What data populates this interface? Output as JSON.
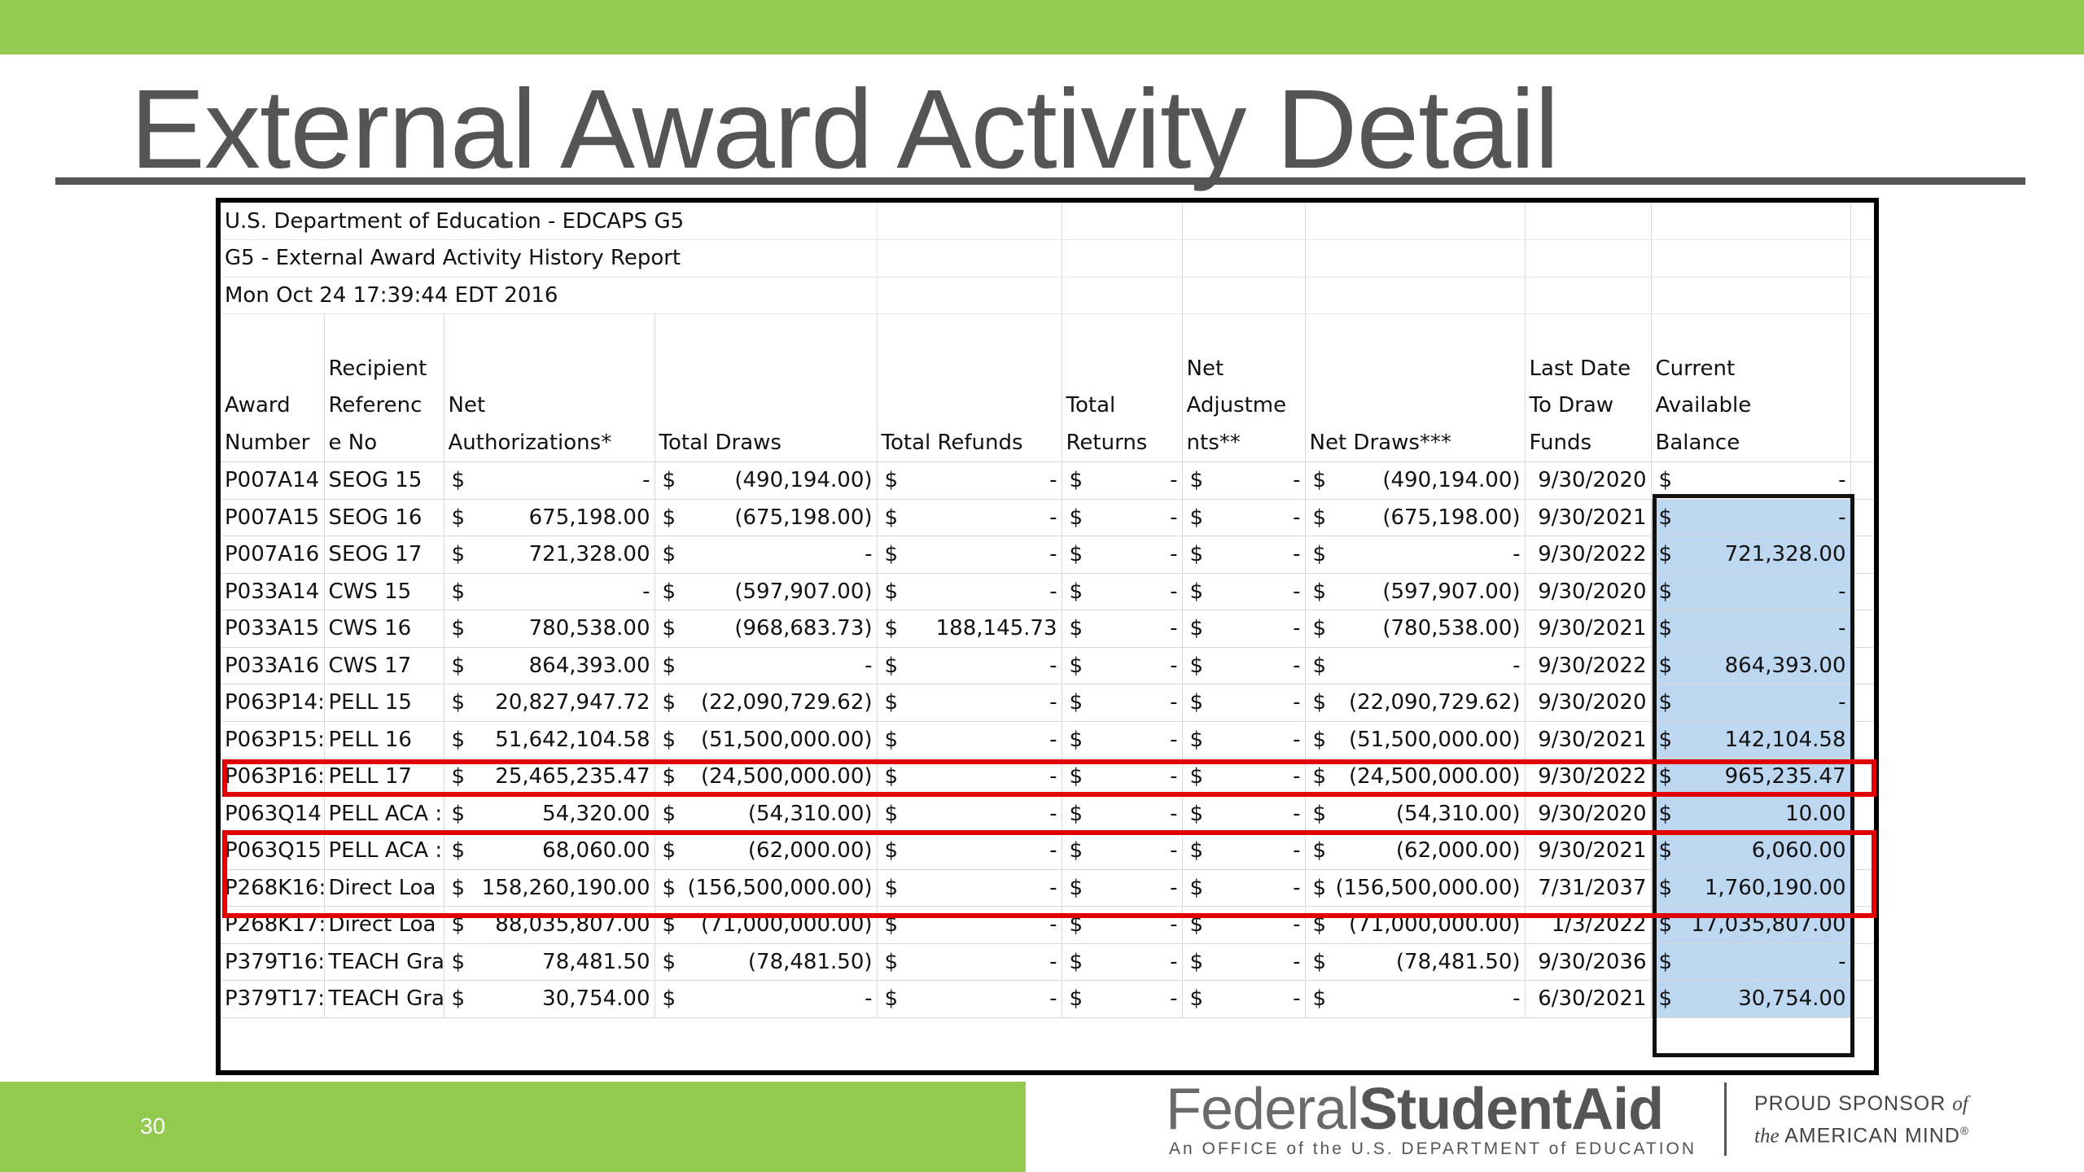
{
  "slide": {
    "title": "External Award Activity Detail",
    "page_number": "30"
  },
  "report": {
    "line1": "U.S. Department of Education - EDCAPS G5",
    "line2": "G5 - External Award Activity History Report",
    "line3": "Mon Oct 24 17:39:44 EDT 2016"
  },
  "headers": {
    "award_number": [
      "",
      "Award",
      "Number"
    ],
    "recipient_ref": [
      "Recipient",
      "Referenc",
      "e No"
    ],
    "net_auth": [
      "",
      "Net",
      "Authorizations*"
    ],
    "total_draws": [
      "",
      "",
      "Total Draws"
    ],
    "total_refunds": [
      "",
      "",
      "Total Refunds"
    ],
    "total_returns": [
      "",
      "Total",
      "Returns"
    ],
    "net_adjustments": [
      "Net",
      "Adjustme",
      "nts**"
    ],
    "net_draws": [
      "",
      "",
      "Net Draws***"
    ],
    "last_date": [
      "Last Date",
      "To Draw",
      "Funds"
    ],
    "current_balance": [
      "Current",
      "Available",
      "Balance"
    ]
  },
  "currency_symbol": "$",
  "dash": "-",
  "rows": [
    {
      "award": "P007A14",
      "ref": "SEOG 15",
      "net_auth": "-",
      "total_draws": "(490,194.00)",
      "total_refunds": "-",
      "total_returns": "-",
      "net_adj": "-",
      "net_draws": "(490,194.00)",
      "last_date": "9/30/2020",
      "balance": "-"
    },
    {
      "award": "P007A15",
      "ref": "SEOG 16",
      "net_auth": "675,198.00",
      "total_draws": "(675,198.00)",
      "total_refunds": "-",
      "total_returns": "-",
      "net_adj": "-",
      "net_draws": "(675,198.00)",
      "last_date": "9/30/2021",
      "balance": "-"
    },
    {
      "award": "P007A16",
      "ref": "SEOG 17",
      "net_auth": "721,328.00",
      "total_draws": "-",
      "total_refunds": "-",
      "total_returns": "-",
      "net_adj": "-",
      "net_draws": "-",
      "last_date": "9/30/2022",
      "balance": "721,328.00"
    },
    {
      "award": "P033A14",
      "ref": "CWS 15",
      "net_auth": "-",
      "total_draws": "(597,907.00)",
      "total_refunds": "-",
      "total_returns": "-",
      "net_adj": "-",
      "net_draws": "(597,907.00)",
      "last_date": "9/30/2020",
      "balance": "-"
    },
    {
      "award": "P033A15",
      "ref": "CWS 16",
      "net_auth": "780,538.00",
      "total_draws": "(968,683.73)",
      "total_refunds": "188,145.73",
      "total_returns": "-",
      "net_adj": "-",
      "net_draws": "(780,538.00)",
      "last_date": "9/30/2021",
      "balance": "-"
    },
    {
      "award": "P033A16",
      "ref": "CWS 17",
      "net_auth": "864,393.00",
      "total_draws": "-",
      "total_refunds": "-",
      "total_returns": "-",
      "net_adj": "-",
      "net_draws": "-",
      "last_date": "9/30/2022",
      "balance": "864,393.00"
    },
    {
      "award": "P063P14:",
      "ref": "PELL 15",
      "net_auth": "20,827,947.72",
      "total_draws": "(22,090,729.62)",
      "total_refunds": "-",
      "total_returns": "-",
      "net_adj": "-",
      "net_draws": "(22,090,729.62)",
      "last_date": "9/30/2020",
      "balance": "-"
    },
    {
      "award": "P063P15:",
      "ref": "PELL 16",
      "net_auth": "51,642,104.58",
      "total_draws": "(51,500,000.00)",
      "total_refunds": "-",
      "total_returns": "-",
      "net_adj": "-",
      "net_draws": "(51,500,000.00)",
      "last_date": "9/30/2021",
      "balance": "142,104.58"
    },
    {
      "award": "P063P16:",
      "ref": "PELL 17",
      "net_auth": "25,465,235.47",
      "total_draws": "(24,500,000.00)",
      "total_refunds": "-",
      "total_returns": "-",
      "net_adj": "-",
      "net_draws": "(24,500,000.00)",
      "last_date": "9/30/2022",
      "balance": "965,235.47"
    },
    {
      "award": "P063Q14",
      "ref": "PELL ACA :",
      "net_auth": "54,320.00",
      "total_draws": "(54,310.00)",
      "total_refunds": "-",
      "total_returns": "-",
      "net_adj": "-",
      "net_draws": "(54,310.00)",
      "last_date": "9/30/2020",
      "balance": "10.00"
    },
    {
      "award": "P063Q15",
      "ref": "PELL ACA :",
      "net_auth": "68,060.00",
      "total_draws": "(62,000.00)",
      "total_refunds": "-",
      "total_returns": "-",
      "net_adj": "-",
      "net_draws": "(62,000.00)",
      "last_date": "9/30/2021",
      "balance": "6,060.00"
    },
    {
      "award": "P268K16:",
      "ref": "Direct Loa",
      "net_auth": "158,260,190.00",
      "total_draws": "(156,500,000.00)",
      "total_refunds": "-",
      "total_returns": "-",
      "net_adj": "-",
      "net_draws": "(156,500,000.00)",
      "last_date": "7/31/2037",
      "balance": "1,760,190.00"
    },
    {
      "award": "P268K17:",
      "ref": "Direct Loa",
      "net_auth": "88,035,807.00",
      "total_draws": "(71,000,000.00)",
      "total_refunds": "-",
      "total_returns": "-",
      "net_adj": "-",
      "net_draws": "(71,000,000.00)",
      "last_date": "1/3/2022",
      "balance": "17,035,807.00"
    },
    {
      "award": "P379T16:",
      "ref": "TEACH Gra",
      "net_auth": "78,481.50",
      "total_draws": "(78,481.50)",
      "total_refunds": "-",
      "total_returns": "-",
      "net_adj": "-",
      "net_draws": "(78,481.50)",
      "last_date": "9/30/2036",
      "balance": "-"
    },
    {
      "award": "P379T17:",
      "ref": "TEACH Gra",
      "net_auth": "30,754.00",
      "total_draws": "-",
      "total_refunds": "-",
      "total_returns": "-",
      "net_adj": "-",
      "net_draws": "-",
      "last_date": "6/30/2021",
      "balance": "30,754.00"
    }
  ],
  "footer": {
    "logo_federal": "Federal",
    "logo_student": "Student",
    "logo_aid": "Aid",
    "logo_tagline": "An OFFICE of the U.S. DEPARTMENT of EDUCATION",
    "sponsor_line1": "PROUD SPONSOR",
    "sponsor_of": "of",
    "sponsor_line2_italic": "the",
    "sponsor_line2": "AMERICAN MIND",
    "sponsor_mark": "®"
  },
  "colors": {
    "brand_green": "#92c94f",
    "highlight_red": "#e00000",
    "balance_blue": "#bdd7f1",
    "title_gray": "#555555"
  }
}
